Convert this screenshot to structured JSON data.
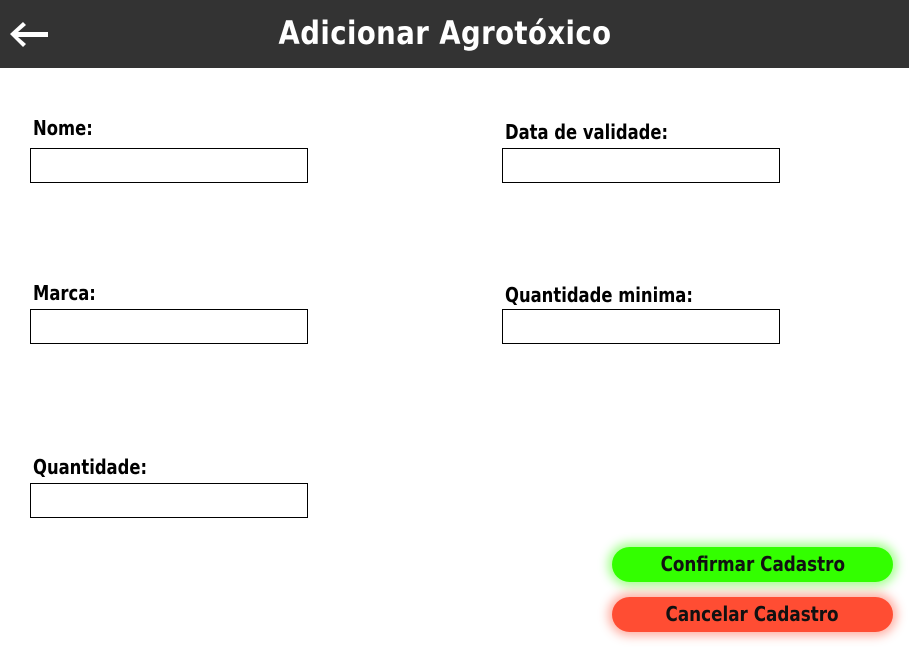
{
  "header": {
    "title": "Adicionar Agrotóxico",
    "back_icon": "arrow-left-icon"
  },
  "form": {
    "fields": [
      {
        "label": "Nome:",
        "value": ""
      },
      {
        "label": "Data de validade:",
        "value": ""
      },
      {
        "label": "Marca:",
        "value": ""
      },
      {
        "label": "Quantidade minima:",
        "value": ""
      },
      {
        "label": "Quantidade:",
        "value": ""
      }
    ]
  },
  "actions": {
    "confirm_label": "Confirmar Cadastro",
    "cancel_label": "Cancelar Cadastro",
    "confirm_color": "#33ff00",
    "cancel_color": "#ff4d33"
  },
  "colors": {
    "header_bg": "#333333",
    "page_bg": "#ffffff"
  }
}
